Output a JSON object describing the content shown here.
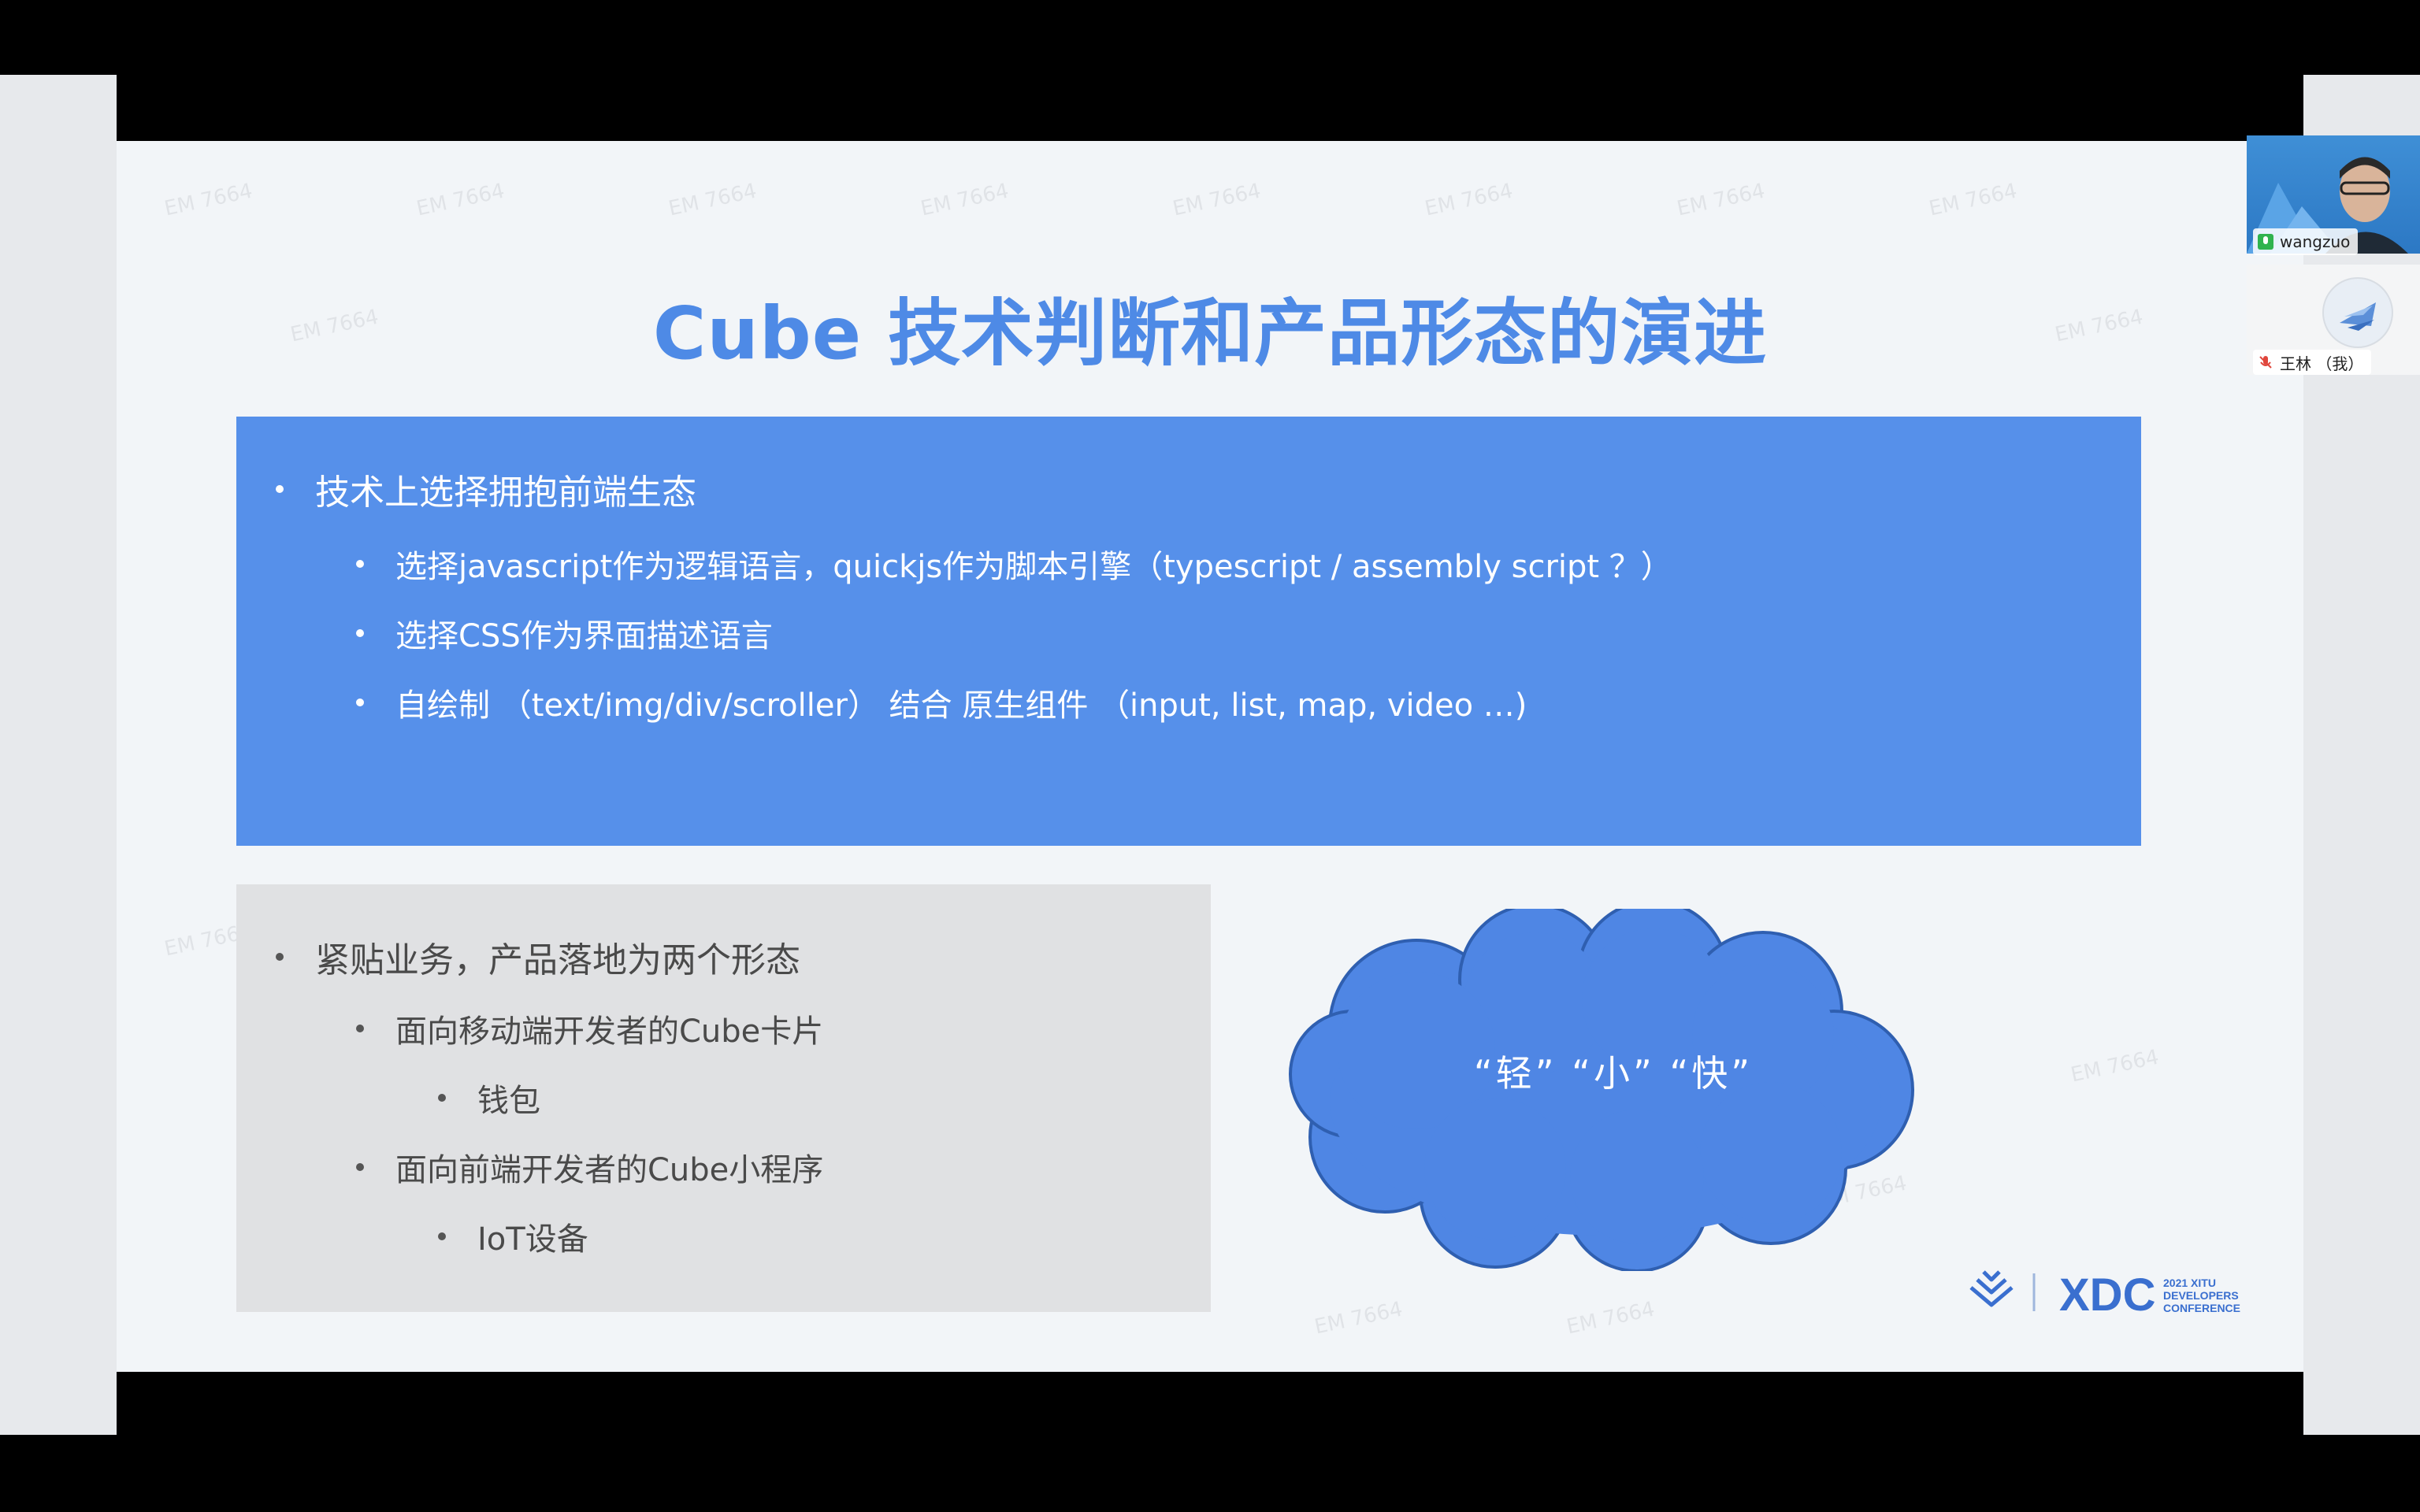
{
  "slide": {
    "title": "Cube 技术判断和产品形态的演进",
    "tech_section": {
      "heading": "技术上选择拥抱前端生态",
      "items": [
        "选择javascript作为逻辑语言，quickjs作为脚本引擎（typescript / assembly script ？）",
        "选择CSS作为界面描述语言",
        "自绘制 （text/img/div/scroller） 结合 原生组件 （input, list, map, video …)"
      ]
    },
    "business_section": {
      "heading": "紧贴业务，产品落地为两个形态",
      "items": [
        {
          "label": "面向移动端开发者的Cube卡片",
          "sub": "钱包"
        },
        {
          "label": "面向前端开发者的Cube小程序",
          "sub": "IoT设备"
        }
      ]
    },
    "cloud_text": "“轻” “小” “快”",
    "logo": {
      "name": "XDC",
      "lines": [
        "2021 XITU",
        "DEVELOPERS",
        "CONFERENCE"
      ]
    },
    "watermark": "EM 7664"
  },
  "participants": [
    {
      "name": "wangzuo",
      "mic": "on"
    },
    {
      "name": "王林 （我）",
      "mic": "muted"
    }
  ],
  "colors": {
    "accent_blue": "#5690ea",
    "title_blue": "#4e8ae6",
    "cloud_blue": "#4f86e4",
    "panel_gray": "#e0e1e3"
  }
}
